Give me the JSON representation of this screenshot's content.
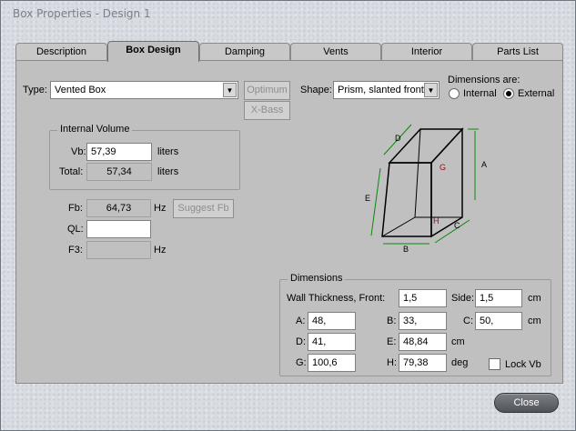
{
  "window": {
    "title": "Box Properties - Design 1"
  },
  "tabs": [
    {
      "label": "Description"
    },
    {
      "label": "Box Design"
    },
    {
      "label": "Damping"
    },
    {
      "label": "Vents"
    },
    {
      "label": "Interior"
    },
    {
      "label": "Parts List"
    }
  ],
  "type": {
    "label": "Type:",
    "value": "Vented Box"
  },
  "buttons": {
    "optimum": "Optimum",
    "xbass": "X-Bass",
    "suggest_fb": "Suggest Fb",
    "close": "Close"
  },
  "shape": {
    "label": "Shape:",
    "value": "Prism, slanted front"
  },
  "dimensions_are": {
    "label": "Dimensions are:",
    "internal": "Internal",
    "external": "External",
    "selected": "External"
  },
  "internal_volume": {
    "title": "Internal Volume",
    "vb_label": "Vb:",
    "vb_value": "57,39",
    "vb_unit": "liters",
    "total_label": "Total:",
    "total_value": "57,34",
    "total_unit": "liters"
  },
  "tuning": {
    "fb_label": "Fb:",
    "fb_value": "64,73",
    "fb_unit": "Hz",
    "ql_label": "QL:",
    "ql_value": "",
    "f3_label": "F3:",
    "f3_value": "",
    "f3_unit": "Hz"
  },
  "diagram": {
    "labels": [
      "D",
      "A",
      "G",
      "E",
      "H",
      "C",
      "B"
    ]
  },
  "dimensions": {
    "title": "Dimensions",
    "wall_label": "Wall Thickness, Front:",
    "wall_front": "1,5",
    "side_label": "Side:",
    "wall_side": "1,5",
    "wall_unit": "cm",
    "a_label": "A:",
    "a": "48,",
    "b_label": "B:",
    "b": "33,",
    "c_label": "C:",
    "c": "50,",
    "abc_unit": "cm",
    "d_label": "D:",
    "d": "41,",
    "e_label": "E:",
    "e": "48,84",
    "de_unit": "cm",
    "g_label": "G:",
    "g": "100,6",
    "h_label": "H:",
    "h": "79,38",
    "gh_unit": "deg",
    "lock_label": "Lock Vb"
  }
}
